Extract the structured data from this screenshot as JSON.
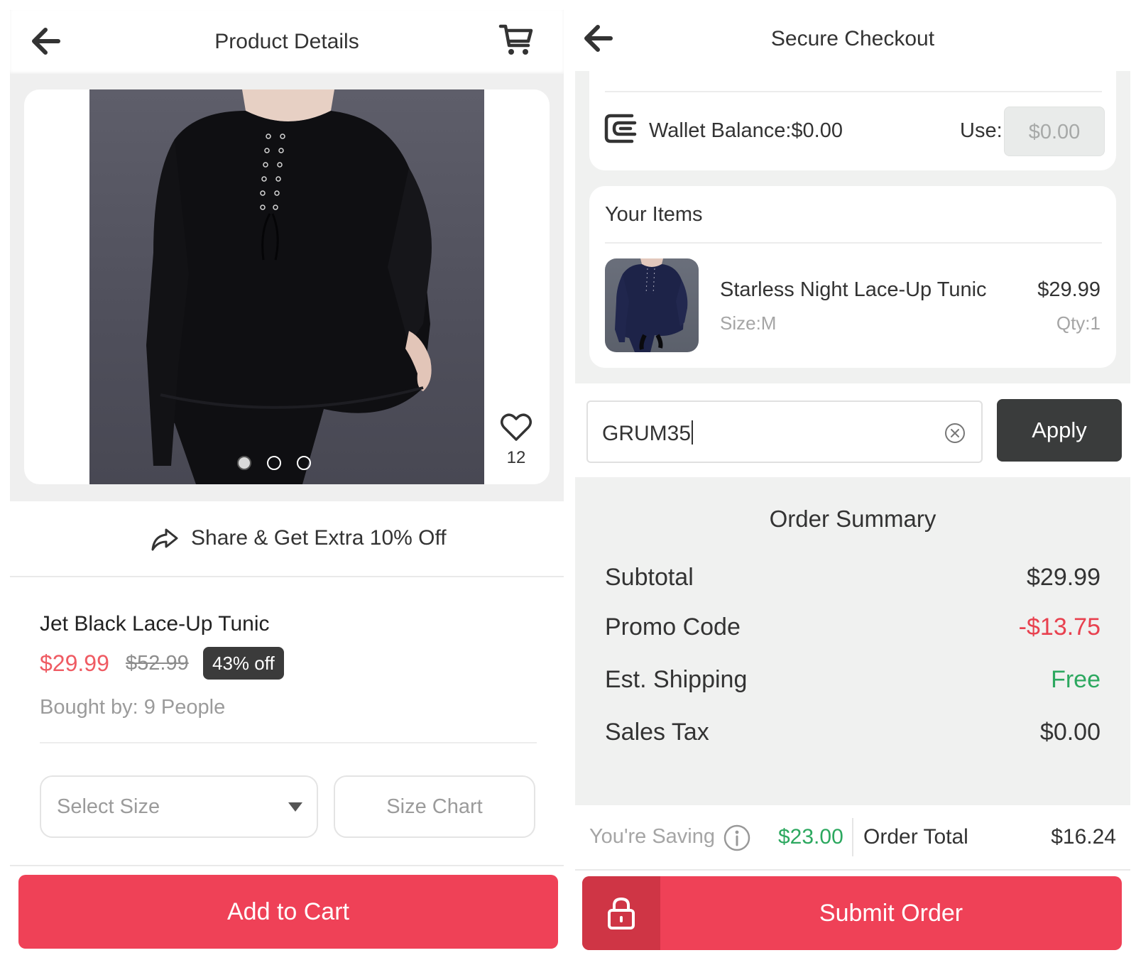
{
  "left": {
    "header": {
      "title": "Product Details"
    },
    "gallery": {
      "likes": "12"
    },
    "share": {
      "label": "Share & Get Extra 10% Off"
    },
    "product": {
      "name": "Jet Black Lace-Up Tunic",
      "price": "$29.99",
      "old_price": "$52.99",
      "discount": "43% off",
      "bought_by": "Bought by: 9 People"
    },
    "size_select": {
      "placeholder": "Select Size"
    },
    "size_chart": {
      "label": "Size Chart"
    },
    "add_to_cart": {
      "label": "Add to Cart"
    }
  },
  "right": {
    "header": {
      "title": "Secure Checkout"
    },
    "wallet": {
      "text": "Wallet Balance:$0.00",
      "use_label": "Use:",
      "use_value": "$0.00"
    },
    "items": {
      "title": "Your Items",
      "list": [
        {
          "name": "Starless Night Lace-Up Tunic",
          "size": "Size:M",
          "price": "$29.99",
          "qty": "Qty:1"
        }
      ]
    },
    "promo": {
      "value": "GRUM35",
      "apply_label": "Apply"
    },
    "summary": {
      "title": "Order Summary",
      "rows": [
        {
          "label": "Subtotal",
          "value": "$29.99"
        },
        {
          "label": "Promo Code",
          "value": "-$13.75"
        },
        {
          "label": "Est. Shipping",
          "value": "Free"
        },
        {
          "label": "Sales Tax",
          "value": "$0.00"
        }
      ]
    },
    "saving": {
      "label": "You're Saving",
      "amount": "$23.00",
      "total_label": "Order Total",
      "total_value": "$16.24"
    },
    "submit": {
      "label": "Submit Order"
    }
  },
  "colors": {
    "accent": "#ef4157",
    "price_red": "#ef5b63",
    "promo_red": "#e8414f",
    "free_green": "#2ca85f",
    "dark_button": "#3a3c3c"
  },
  "icons": {
    "back": "back-arrow-icon",
    "cart": "cart-icon",
    "heart": "heart-icon",
    "share": "share-icon",
    "wallet": "wallet-icon",
    "clear": "clear-icon",
    "info": "info-icon",
    "lock": "lock-icon"
  }
}
